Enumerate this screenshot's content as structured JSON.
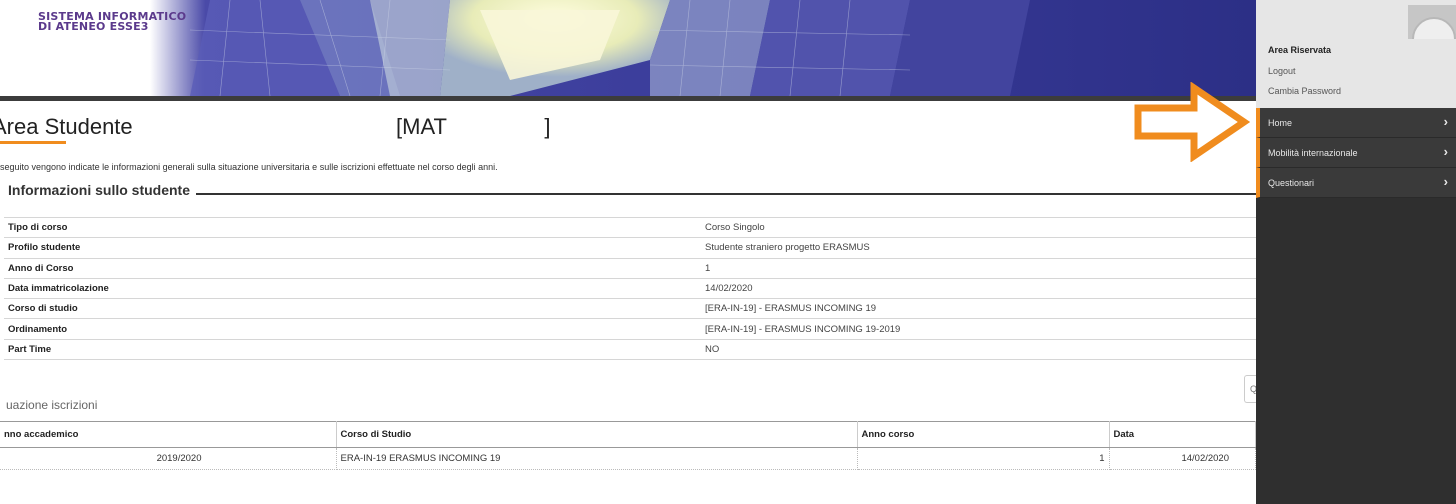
{
  "header": {
    "institution_line1": "SISTEMA INFORMATICO",
    "institution_line2": "DI ATENEO ESSE3"
  },
  "page": {
    "title": "Area Studente",
    "matricola": "[MAT                ]",
    "intro": "seguito vengono indicate le informazioni generali sulla situazione universitaria e sulle iscrizioni effettuate nel corso degli anni."
  },
  "student_info": {
    "heading": "Informazioni sullo studente",
    "rows": [
      {
        "label": "Tipo di corso",
        "value": "Corso Singolo"
      },
      {
        "label": "Profilo studente",
        "value": "Studente straniero progetto ERASMUS"
      },
      {
        "label": "Anno di Corso",
        "value": "1"
      },
      {
        "label": "Data immatricolazione",
        "value": "14/02/2020"
      },
      {
        "label": "Corso di studio",
        "value": "[ERA-IN-19] - ERASMUS INCOMING 19"
      },
      {
        "label": "Ordinamento",
        "value": "[ERA-IN-19] - ERASMUS INCOMING 19-2019"
      },
      {
        "label": "Part Time",
        "value": "NO"
      }
    ]
  },
  "iscrizioni": {
    "heading": "uazione iscrizioni",
    "search_glyph": "Q",
    "columns": [
      "nno accademico",
      "Corso di Studio",
      "Anno corso",
      "Data"
    ],
    "rows": [
      {
        "anno_accademico": "2019/2020",
        "corso": "ERA-IN-19 ERASMUS INCOMING 19",
        "anno_corso": "1",
        "data": "14/02/2020"
      }
    ]
  },
  "sidebar": {
    "area_label": "Area Riservata",
    "logout": "Logout",
    "change_password": "Cambia Password",
    "menu": [
      {
        "label": "Home",
        "icon": "chevron-right-icon"
      },
      {
        "label": "Mobilità internazionale",
        "icon": "chevron-right-icon"
      },
      {
        "label": "Questionari",
        "icon": "chevron-right-icon"
      }
    ]
  },
  "colors": {
    "accent": "#f08c1e",
    "sidebar_bg": "#2f2f2f",
    "header_text": "#5b3a8c"
  }
}
